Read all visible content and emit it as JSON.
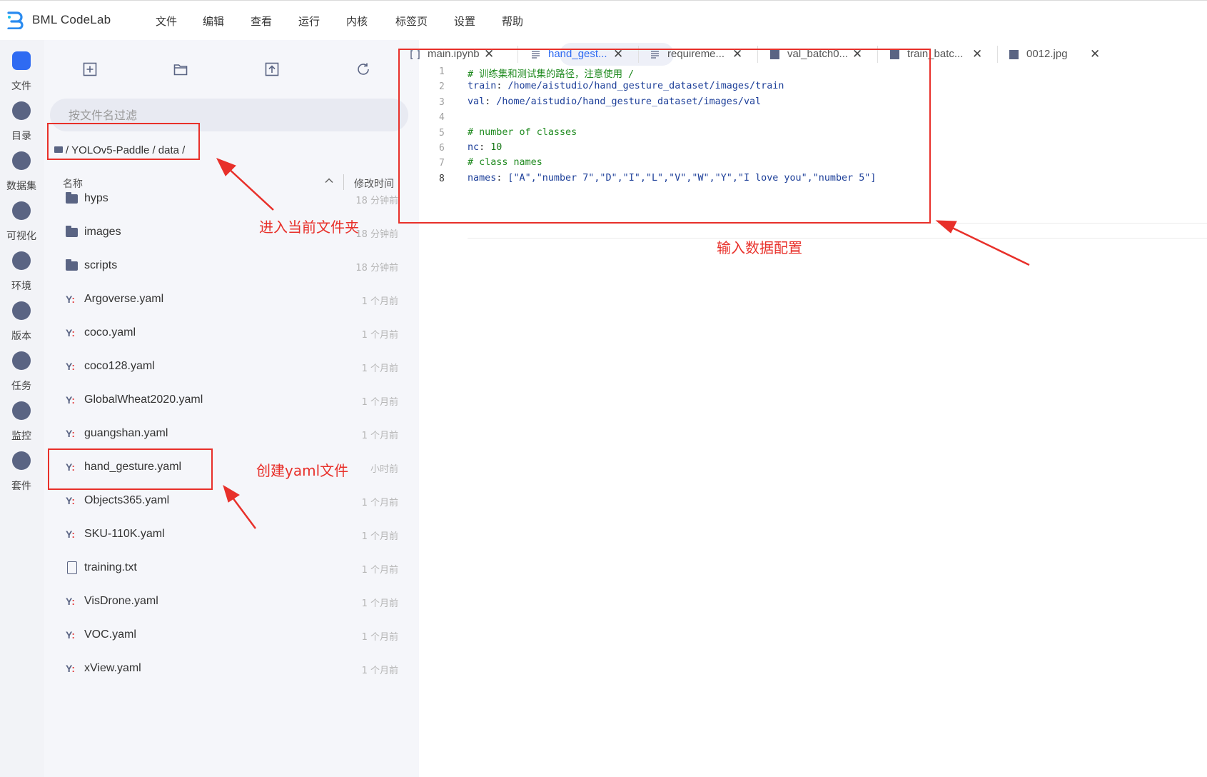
{
  "app": {
    "brand": "BML CodeLab",
    "accent_color": "#2f6bf2",
    "annotation_color": "#e8302a"
  },
  "menu": [
    "文件",
    "编辑",
    "查看",
    "运行",
    "内核",
    "标签页",
    "设置",
    "帮助"
  ],
  "rail": [
    {
      "label": "文件",
      "icon": "folder-icon",
      "active": true
    },
    {
      "label": "目录",
      "icon": "list-icon"
    },
    {
      "label": "数据集",
      "icon": "dataset-icon"
    },
    {
      "label": "可视化",
      "icon": "chart-icon"
    },
    {
      "label": "环境",
      "icon": "environment-icon"
    },
    {
      "label": "版本",
      "icon": "clock-icon"
    },
    {
      "label": "任务",
      "icon": "task-icon"
    },
    {
      "label": "监控",
      "icon": "monitor-icon"
    },
    {
      "label": "套件",
      "icon": "suite-icon"
    }
  ],
  "files": {
    "filter_placeholder": "按文件名过滤",
    "breadcrumb": "/ YOLOv5-Paddle / data /",
    "columns": {
      "name": "名称",
      "modified": "修改时间"
    },
    "items": [
      {
        "name": "hyps",
        "type": "folder",
        "modified": "18 分钟前"
      },
      {
        "name": "images",
        "type": "folder",
        "modified": "18 分钟前"
      },
      {
        "name": "scripts",
        "type": "folder",
        "modified": "18 分钟前"
      },
      {
        "name": "Argoverse.yaml",
        "type": "yaml",
        "modified": "1 个月前"
      },
      {
        "name": "coco.yaml",
        "type": "yaml",
        "modified": "1 个月前"
      },
      {
        "name": "coco128.yaml",
        "type": "yaml",
        "modified": "1 个月前"
      },
      {
        "name": "GlobalWheat2020.yaml",
        "type": "yaml",
        "modified": "1 个月前"
      },
      {
        "name": "guangshan.yaml",
        "type": "yaml",
        "modified": "1 个月前"
      },
      {
        "name": "hand_gesture.yaml",
        "type": "yaml",
        "modified": "小时前"
      },
      {
        "name": "Objects365.yaml",
        "type": "yaml",
        "modified": "1 个月前"
      },
      {
        "name": "SKU-110K.yaml",
        "type": "yaml",
        "modified": "1 个月前"
      },
      {
        "name": "training.txt",
        "type": "file",
        "modified": "1 个月前"
      },
      {
        "name": "VisDrone.yaml",
        "type": "yaml",
        "modified": "1 个月前"
      },
      {
        "name": "VOC.yaml",
        "type": "yaml",
        "modified": "1 个月前"
      },
      {
        "name": "xView.yaml",
        "type": "yaml",
        "modified": "1 个月前"
      }
    ]
  },
  "tabs": [
    {
      "label": "main.ipynb",
      "icon": "notebook-icon"
    },
    {
      "label": "hand_gest...",
      "icon": "text-file-icon",
      "active": true
    },
    {
      "label": "requireme...",
      "icon": "text-file-icon"
    },
    {
      "label": "val_batch0...",
      "icon": "image-icon"
    },
    {
      "label": "train_batc...",
      "icon": "image-icon"
    },
    {
      "label": "0012.jpg",
      "icon": "image-icon"
    }
  ],
  "editor": {
    "current_line": 8,
    "lines": [
      {
        "n": "1",
        "text": "# 训练集和测试集的路径，注意使用 /"
      },
      {
        "n": "2",
        "key": "train",
        "value": " /home/aistudio/hand_gesture_dataset/images/train"
      },
      {
        "n": "3",
        "key": "val",
        "value": " /home/aistudio/hand_gesture_dataset/images/val"
      },
      {
        "n": "4",
        "text": ""
      },
      {
        "n": "5",
        "text": "# number of classes"
      },
      {
        "n": "6",
        "key": "nc",
        "value": " 10"
      },
      {
        "n": "7",
        "text": "# class names"
      },
      {
        "n": "8",
        "key": "names",
        "value": " [\"A\",\"number 7\",\"D\",\"I\",\"L\",\"V\",\"W\",\"Y\",\"I love you\",\"number 5\"]"
      }
    ]
  },
  "annotations": {
    "enter_folder": "进入当前文件夹",
    "create_yaml": "创建yaml文件",
    "input_config": "输入数据配置"
  }
}
